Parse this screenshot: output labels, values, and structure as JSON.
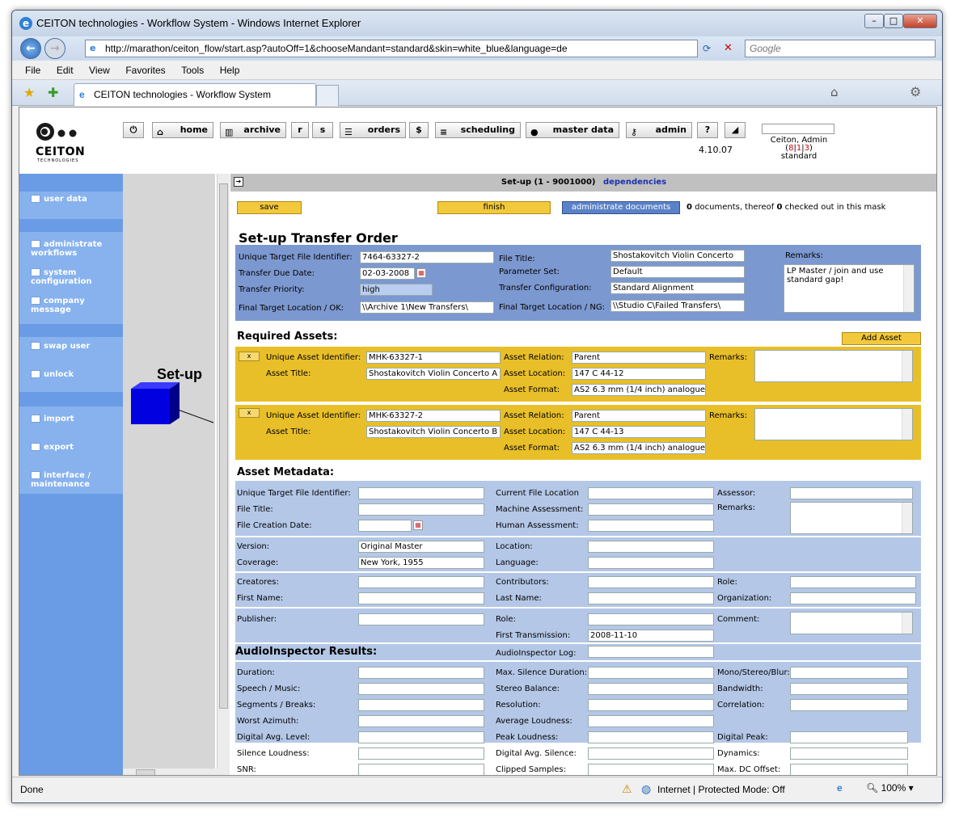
{
  "window": {
    "title": "CEITON technologies - Workflow System - Windows Internet Explorer"
  },
  "browser": {
    "url": "http://marathon/ceiton_flow/start.asp?autoOff=1&chooseMandant=standard&skin=white_blue&language=de",
    "search_placeholder": "Google",
    "tab_title": "CEITON technologies - Workflow System",
    "menu": [
      "File",
      "Edit",
      "View",
      "Favorites",
      "Tools",
      "Help"
    ]
  },
  "app": {
    "logo_text": "CEITON",
    "logo_sub": "TECHNOLOGIES",
    "toolbar": {
      "home": "home",
      "archive": "archive",
      "r": "r",
      "s": "s",
      "orders": "orders",
      "dollar": "$",
      "scheduling": "scheduling",
      "master_data": "master data",
      "admin": "admin",
      "help": "?"
    },
    "version": "4.10.07",
    "user_name": "Ceiton, Admin",
    "user_counts": [
      "8",
      "1",
      "3"
    ],
    "user_mandant": "standard"
  },
  "leftnav": {
    "items": [
      "user data",
      "administrate workflows",
      "system configuration",
      "company message",
      "swap user",
      "unlock",
      "import",
      "export",
      "interface / maintenance"
    ]
  },
  "canvas": {
    "label": "Set-up"
  },
  "main": {
    "header": "Set-up (1 - 9001000)",
    "dependencies": "dependencies",
    "save": "save",
    "finish": "finish",
    "administrate": "administrate documents",
    "doc_info": {
      "count": "0",
      "middle": "documents, thereof",
      "checked": "0",
      "end": "checked out in this mask"
    },
    "transfer": {
      "title": "Set-up Transfer Order",
      "utfi_label": "Unique Target File Identifier:",
      "utfi": "7464-63327-2",
      "due_label": "Transfer Due Date:",
      "due": "02-03-2008",
      "prio_label": "Transfer Priority:",
      "prio": "high",
      "ok_label": "Final Target Location / OK:",
      "ok": "\\\\Archive 1\\New Transfers\\",
      "ft_label": "File Title:",
      "ft": "Shostakovitch Violin Concerto",
      "ps_label": "Parameter Set:",
      "ps": "Default",
      "tc_label": "Transfer Configuration:",
      "tc": "Standard Alignment",
      "ng_label": "Final Target Location / NG:",
      "ng": "\\\\Studio C\\Failed Transfers\\",
      "rem_label": "Remarks:",
      "rem": "LP Master / join and use standard gap!"
    },
    "assets": {
      "title": "Required Assets:",
      "add": "Add Asset",
      "x": "x",
      "lbl_uai": "Unique Asset Identifier:",
      "lbl_at": "Asset Title:",
      "lbl_ar": "Asset Relation:",
      "lbl_al": "Asset Location:",
      "lbl_af": "Asset Format:",
      "lbl_rem": "Remarks:",
      "items": [
        {
          "uai": "MHK-63327-1",
          "title": "Shostakovitch Violin Concerto A",
          "rel": "Parent",
          "loc": "147 C 44-12",
          "fmt": "AS2 6.3 mm (1/4 inch) analogue"
        },
        {
          "uai": "MHK-63327-2",
          "title": "Shostakovitch Violin Concerto B",
          "rel": "Parent",
          "loc": "147 C 44-13",
          "fmt": "AS2 6.3 mm (1/4 inch) analogue"
        }
      ]
    },
    "meta": {
      "title": "Asset Metadata:",
      "utfi": "Unique Target File Identifier:",
      "ft": "File Title:",
      "fcd": "File Creation Date:",
      "cfl": "Current File Location",
      "ma": "Machine Assessment:",
      "ha": "Human Assessment:",
      "assessor": "Assessor:",
      "remarks": "Remarks:",
      "version": "Version:",
      "version_val": "Original Master",
      "coverage": "Coverage:",
      "coverage_val": "New York, 1955",
      "location": "Location:",
      "language": "Language:",
      "creatores": "Creatores:",
      "firstname": "First Name:",
      "contributors": "Contributors:",
      "lastname": "Last Name:",
      "role": "Role:",
      "org": "Organization:",
      "publisher": "Publisher:",
      "role2": "Role:",
      "ft2": "First Transmission:",
      "ft2_val": "2008-11-10",
      "comment": "Comment:"
    },
    "audio": {
      "title": "AudioInspector Results:",
      "log": "AudioInspector Log:",
      "left": [
        "Duration:",
        "Speech / Music:",
        "Segments / Breaks:",
        "Worst Azimuth:",
        "Digital Avg. Level:",
        "Silence Loudness:",
        "SNR:"
      ],
      "mid": [
        "Max. Silence Duration:",
        "Stereo Balance:",
        "Resolution:",
        "Average Loudness:",
        "Peak Loudness:",
        "Digital Avg. Silence:",
        "Clipped Samples:"
      ],
      "right": [
        "Mono/Stereo/Blur:",
        "Bandwidth:",
        "Correlation:",
        "",
        "Digital Peak:",
        "Dynamics:",
        "Max. DC Offset:"
      ]
    }
  },
  "status": {
    "left": "Done",
    "zone": "Internet | Protected Mode: Off",
    "zoom": "100%"
  }
}
